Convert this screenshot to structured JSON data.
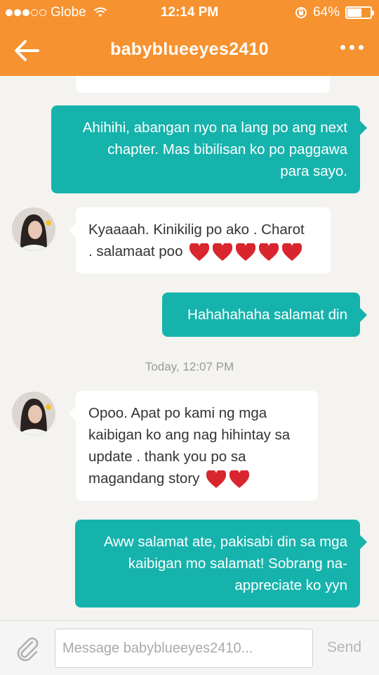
{
  "status_bar": {
    "carrier": "Globe",
    "time": "12:14 PM",
    "battery_percent": "64%",
    "battery_level": 0.64,
    "signal_strength": 3
  },
  "header": {
    "title": "babyblueeyes2410",
    "background_color": "#f6922f"
  },
  "messages": [
    {
      "direction": "out",
      "lines": [
        "Ahihihi, abangan nyo na lang po ang next",
        "chapter. Mas bibilisan ko po paggawa",
        "para sayo."
      ]
    },
    {
      "direction": "in",
      "lines": [
        "Kyaaaah. Kinikilig po ako . Charot",
        ". salamaat poo"
      ],
      "hearts": 5
    },
    {
      "direction": "out",
      "lines": [
        "Hahahahaha salamat din"
      ]
    },
    {
      "direction": "in",
      "lines": [
        "Opoo. Apat po kami ng mga",
        "kaibigan ko ang nag hihintay sa",
        "update . thank you po sa",
        "magandang story"
      ],
      "hearts": 2
    },
    {
      "direction": "out",
      "lines": [
        "Aww salamat ate, pakisabi din sa mga",
        "kaibigan mo salamat! Sobrang na-",
        "appreciate ko yyn"
      ]
    }
  ],
  "timestamp_divider": "Today, 12:07 PM",
  "composer": {
    "placeholder": "Message babyblueeyes2410...",
    "send_label": "Send"
  },
  "colors": {
    "accent": "#f6922f",
    "outgoing_bubble": "#16b3ac",
    "incoming_bubble": "#ffffff",
    "chat_background": "#f4f3ef"
  }
}
